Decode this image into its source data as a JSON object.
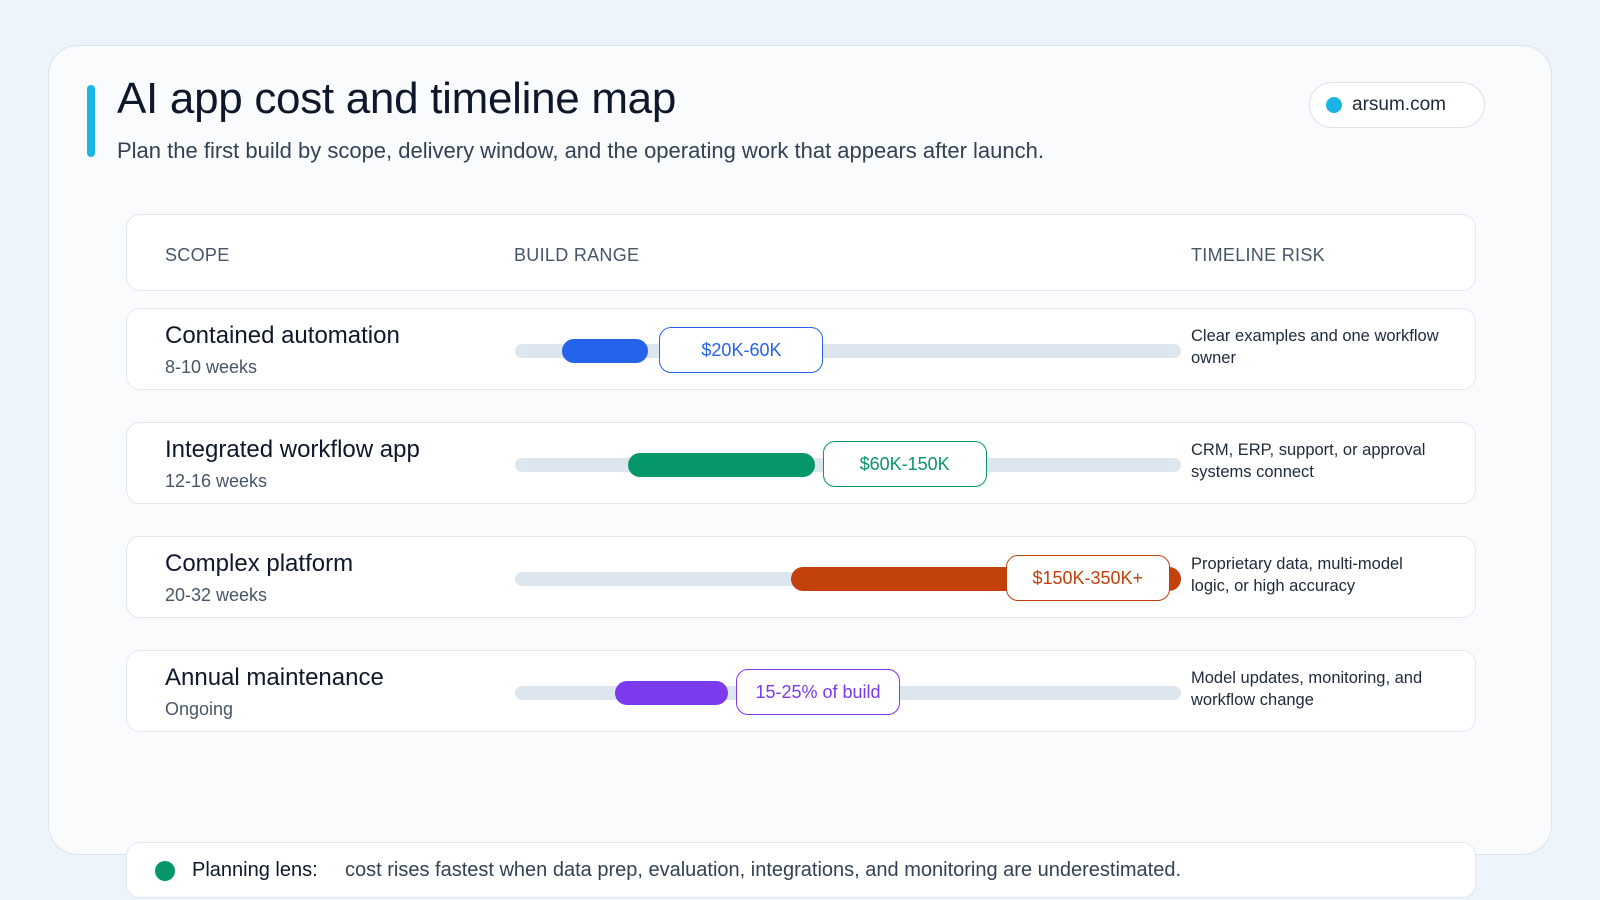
{
  "header": {
    "title": "AI app cost and timeline map",
    "subtitle": "Plan the first build by scope, delivery window, and the operating work that appears after launch.",
    "site": "arsum.com"
  },
  "colors": {
    "accent": "#1cb4e5",
    "track": "#dde5ee"
  },
  "columns": {
    "scope": "SCOPE",
    "build_range": "BUILD RANGE",
    "timeline_risk": "TIMELINE RISK"
  },
  "chart_data": {
    "type": "bar",
    "rows": [
      {
        "name": "Contained automation",
        "duration": "8-10 weeks",
        "label": "$20K-60K",
        "risk": "Clear examples and one workflow owner",
        "start": 0.07,
        "end": 0.2,
        "label_pos": 0.34,
        "color": "#2563eb",
        "label_color": "#2563eb"
      },
      {
        "name": "Integrated workflow app",
        "duration": "12-16 weeks",
        "label": "$60K-150K",
        "risk": "CRM, ERP, support, or approval systems connect",
        "start": 0.17,
        "end": 0.45,
        "label_pos": 0.585,
        "color": "#059669",
        "label_color": "#059669"
      },
      {
        "name": "Complex platform",
        "duration": "20-32 weeks",
        "label": "$150K-350K+",
        "risk": "Proprietary data, multi-model logic, or high accuracy",
        "start": 0.415,
        "end": 1.0,
        "label_pos": 0.86,
        "color": "#c2410c",
        "label_color": "#c2410c"
      },
      {
        "name": "Annual maintenance",
        "duration": "Ongoing",
        "label": "15-25% of build",
        "risk": "Model updates, monitoring, and workflow change",
        "start": 0.15,
        "end": 0.32,
        "label_pos": 0.455,
        "color": "#7c3aed",
        "label_color": "#7c3aed"
      }
    ]
  },
  "footer": {
    "label": "Planning lens:",
    "text": "cost rises fastest when data prep, evaluation, integrations, and monitoring are underestimated."
  }
}
